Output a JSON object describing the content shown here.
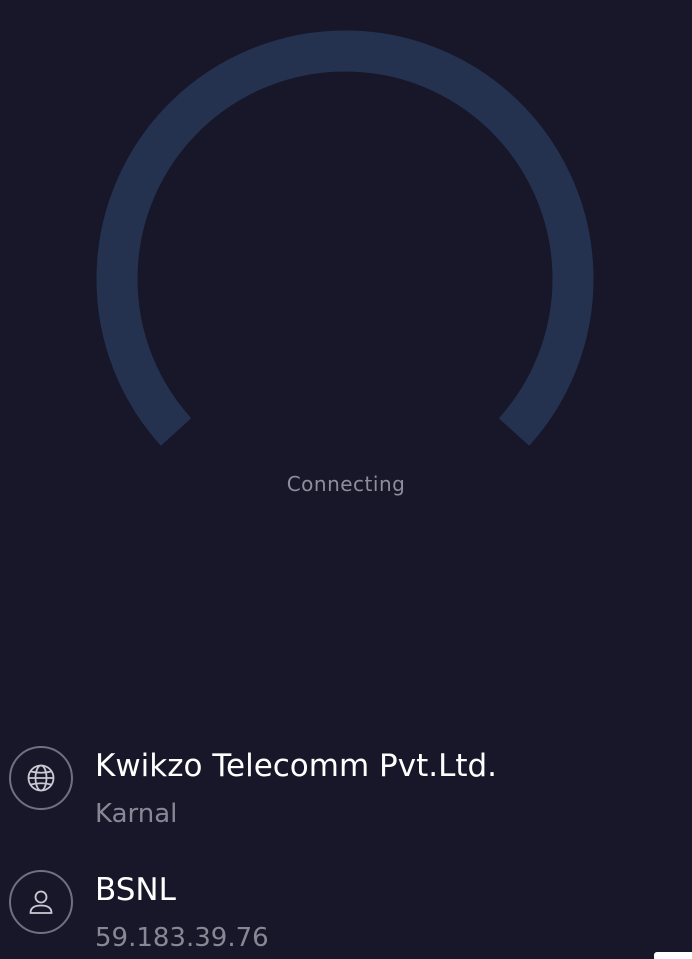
{
  "gauge": {
    "track_color": "#243250"
  },
  "status": {
    "text": "Connecting"
  },
  "provider": {
    "icon": "globe-icon",
    "name": "Kwikzo Telecomm Pvt.Ltd.",
    "location": "Karnal"
  },
  "server": {
    "icon": "user-icon",
    "name": "BSNL",
    "ip": "59.183.39.76"
  }
}
